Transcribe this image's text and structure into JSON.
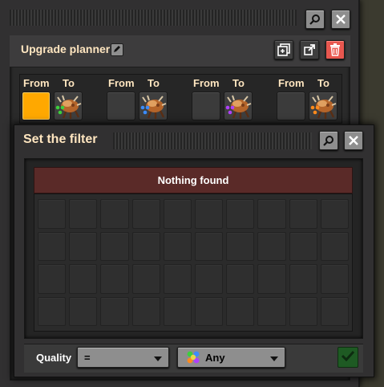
{
  "planner": {
    "title": "Upgrade planner",
    "columns": [
      {
        "from_label": "From",
        "to_label": "To"
      },
      {
        "from_label": "From",
        "to_label": "To"
      },
      {
        "from_label": "From",
        "to_label": "To"
      },
      {
        "from_label": "From",
        "to_label": "To"
      }
    ],
    "mappers": [
      {
        "from_state": "selected",
        "to_icon": "creature-icon",
        "to_badge_icon": "green-quality-icon"
      },
      {
        "from_state": "empty",
        "to_icon": "creature-icon",
        "to_badge_icon": "blue-quality-icon"
      },
      {
        "from_state": "empty",
        "to_icon": "creature-icon",
        "to_badge_icon": "purple-quality-icon"
      },
      {
        "from_state": "empty",
        "to_icon": "creature-icon",
        "to_badge_icon": "orange-quality-icon"
      }
    ],
    "buttons": {
      "search": "search-icon",
      "close": "close-icon",
      "copy": "copy-icon",
      "export": "export-icon",
      "delete": "trash-icon"
    }
  },
  "filter": {
    "title": "Set the filter",
    "empty_message": "Nothing found",
    "grid": {
      "rows": 4,
      "cols": 10
    },
    "quality_label": "Quality",
    "comparator": "=",
    "quality_value": "Any",
    "confirm_icon": "checkmark-icon"
  },
  "colors": {
    "accent_orange": "#ffa800",
    "danger": "#e8574f",
    "empty_bar": "#5a2a28",
    "confirm": "#1e5a23",
    "title_text": "#ffe6c0"
  }
}
